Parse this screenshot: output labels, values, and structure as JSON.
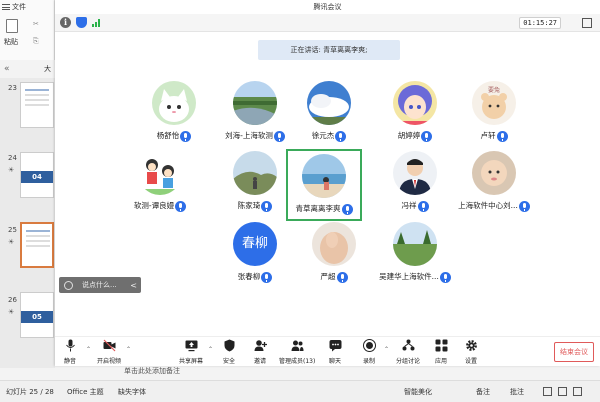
{
  "ppt": {
    "file_label": "文件",
    "paste_label": "粘贴",
    "cut_label": "✂",
    "copy_label": "⎘",
    "collapse_label": "«",
    "outline_label": "大",
    "thumbnails": [
      {
        "num": "23",
        "star": "",
        "band": ""
      },
      {
        "num": "24",
        "star": "☀",
        "band": "04"
      },
      {
        "num": "25",
        "star": "☀",
        "band": ""
      },
      {
        "num": "26",
        "star": "☀",
        "band": "05"
      }
    ],
    "notes_placeholder": "单击此处添加备注",
    "status": {
      "slide": "幻灯片 25 / 28",
      "theme": "Office 主题",
      "missing_font": "缺失字体",
      "beautify": "智能美化",
      "notes": "备注",
      "comments": "批注"
    }
  },
  "meeting": {
    "title": "腾讯会议",
    "timer": "01:15:27",
    "speaking": "正在讲话: 青草离离李爽;",
    "participants": [
      {
        "name": "杨舒怡",
        "avatar": "cat"
      },
      {
        "name": "刘海-上海软测",
        "avatar": "river"
      },
      {
        "name": "徐元杰",
        "avatar": "sky"
      },
      {
        "name": "胡婷婷",
        "avatar": "anime"
      },
      {
        "name": "卢轩",
        "avatar": "bear"
      },
      {
        "name": "软测-谭良嫚",
        "avatar": "kids"
      },
      {
        "name": "陈家琦",
        "avatar": "hill"
      },
      {
        "name": "青草离离李爽",
        "avatar": "beach",
        "active": true
      },
      {
        "name": "冯祥",
        "avatar": "suit"
      },
      {
        "name": "上海软件中心刘...",
        "avatar": "baby"
      },
      {
        "name": "张春柳",
        "avatar": "text",
        "avatar_text": "春柳",
        "avatar_color": "#2d6ee8"
      },
      {
        "name": "严超",
        "avatar": "hand"
      },
      {
        "name": "吴建华上海软件...",
        "avatar": "field"
      }
    ],
    "chat_placeholder": "说点什么...",
    "chat_arrow": "<",
    "toolbar": {
      "mute": "静音",
      "video": "开启视频",
      "share": "共享屏幕",
      "security": "安全",
      "invite": "邀请",
      "members": "管理成员(13)",
      "chat": "聊天",
      "record": "录制",
      "breakout": "分组讨论",
      "apps": "应用",
      "settings": "设置",
      "end": "结束会议"
    },
    "accent_color": "#2d6ee8",
    "active_border_color": "#3aaa5a",
    "end_color": "#e05a5a"
  }
}
